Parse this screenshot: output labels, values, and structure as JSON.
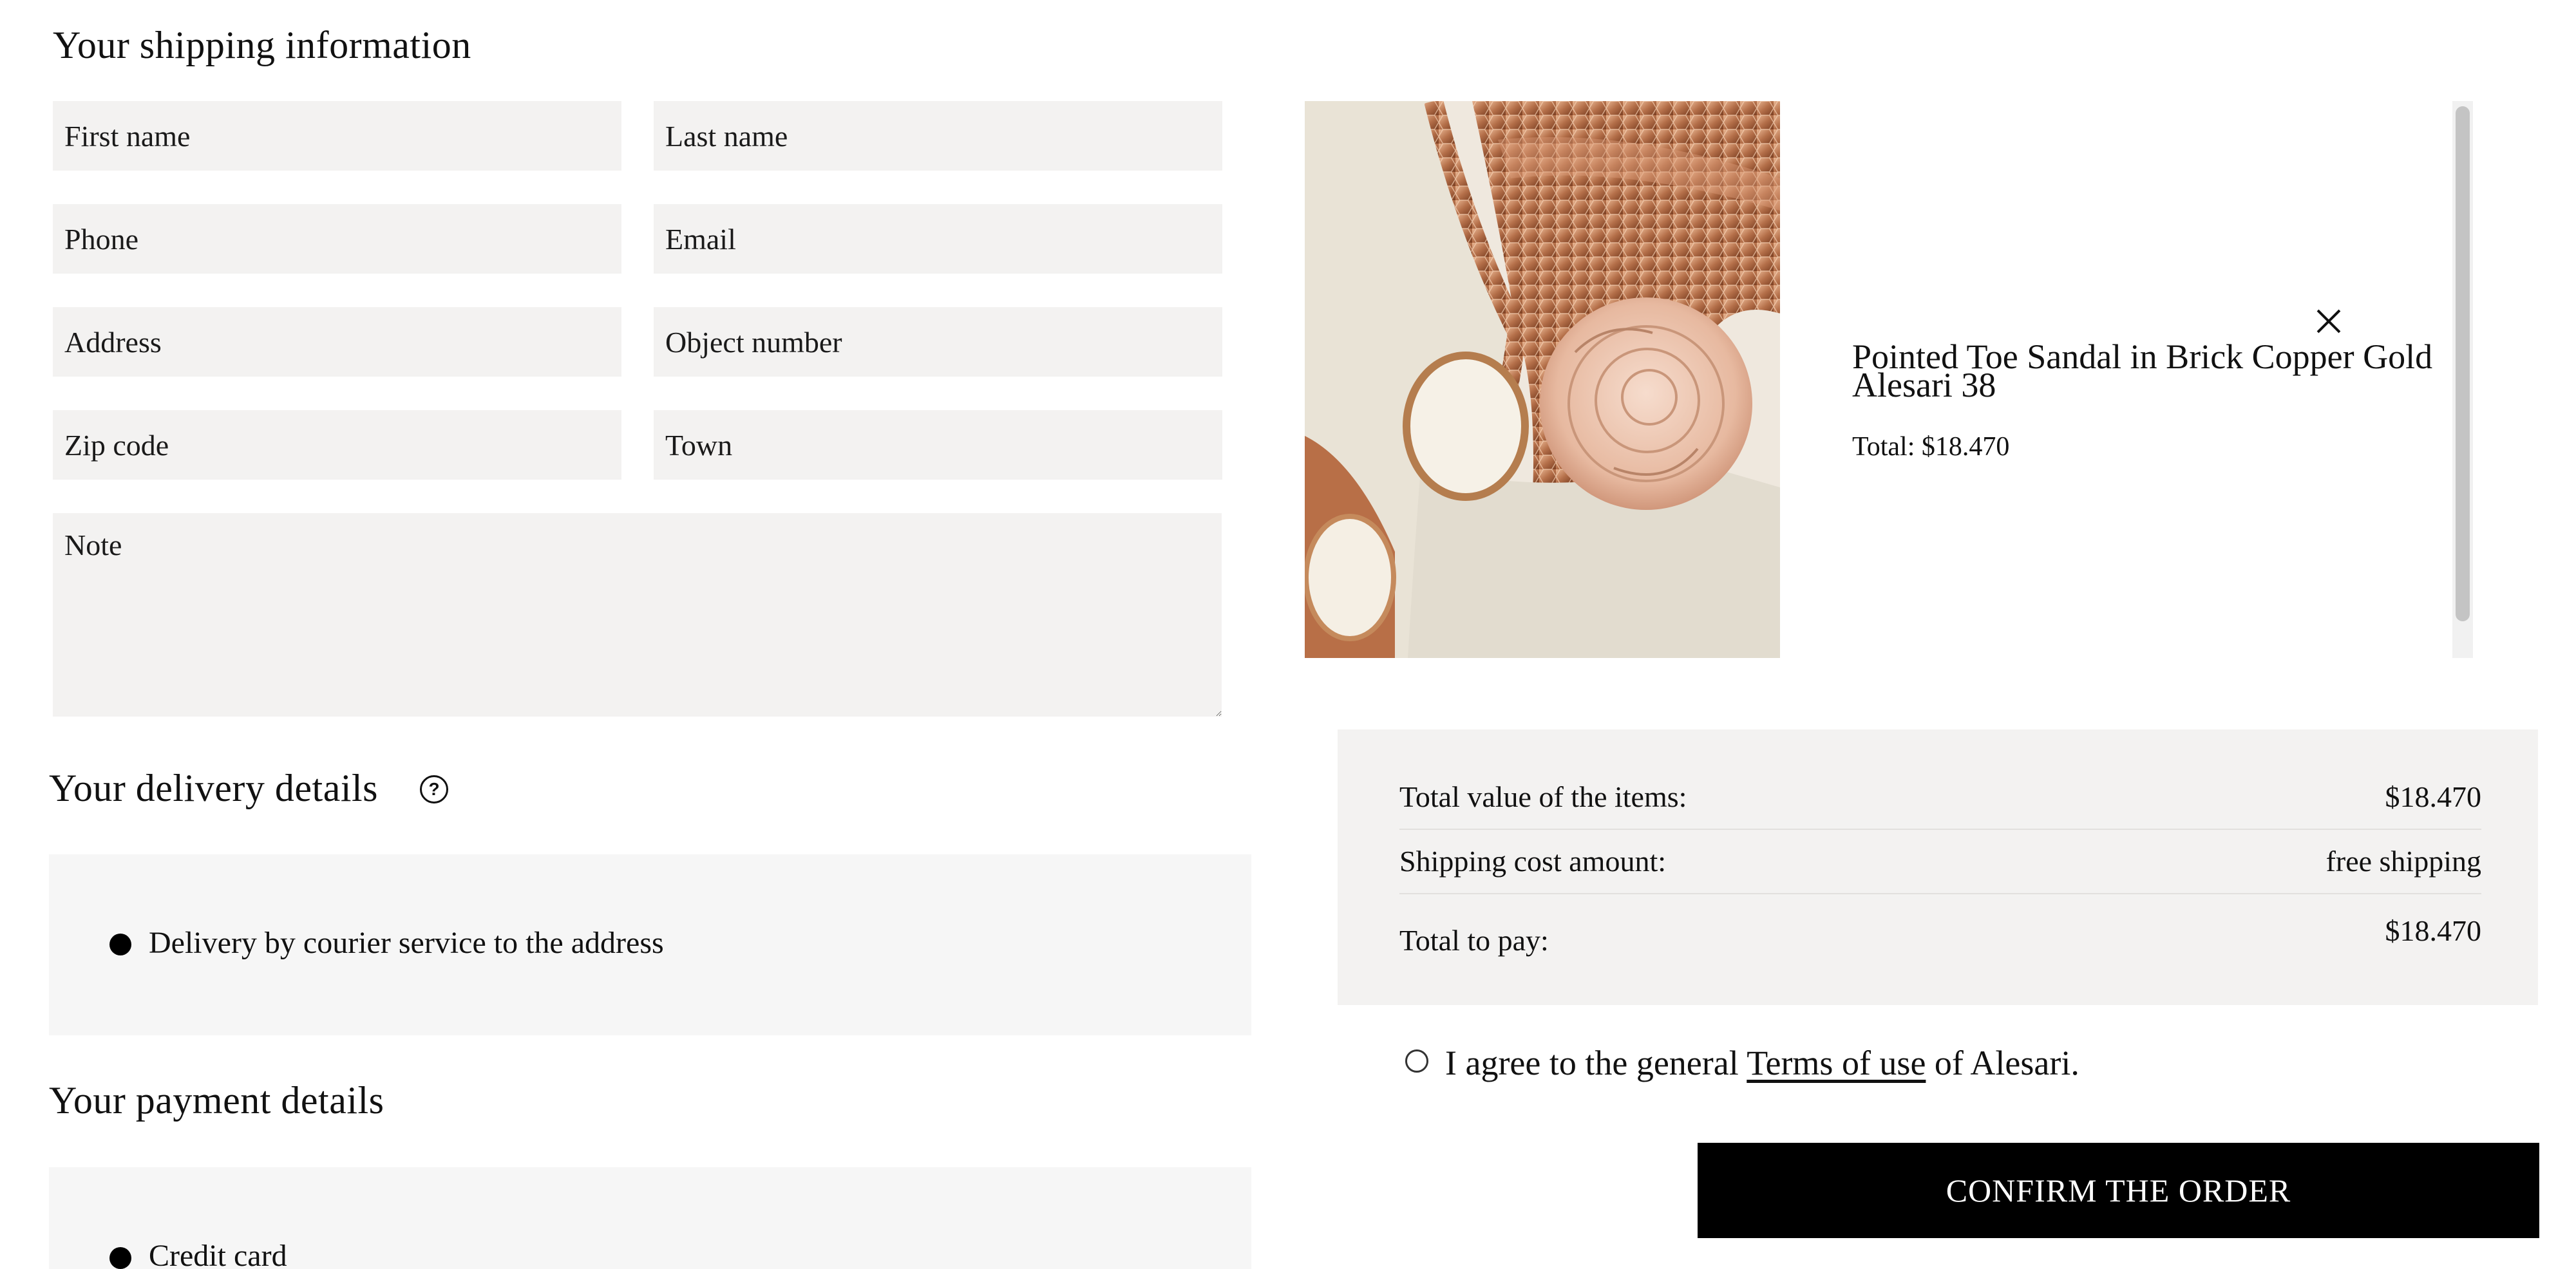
{
  "shipping": {
    "title": "Your shipping information",
    "first_name_placeholder": "First name",
    "last_name_placeholder": "Last name",
    "phone_placeholder": "Phone",
    "email_placeholder": "Email",
    "address_placeholder": "Address",
    "object_number_placeholder": "Object number",
    "zip_placeholder": "Zip code",
    "town_placeholder": "Town",
    "note_placeholder": "Note"
  },
  "delivery": {
    "title": "Your delivery details",
    "help_icon": "question-circle-icon",
    "option_label": "Delivery by courier service to the address"
  },
  "payment": {
    "title": "Your payment details",
    "option_label": "Credit card"
  },
  "product": {
    "name_line1": "Pointed Toe Sandal in Brick Copper Gold",
    "name_line2": "Alesari 38",
    "total": "Total: $18.470",
    "remove_icon": "close-icon"
  },
  "summary": {
    "items_label": "Total value of the items:",
    "items_value": "$18.470",
    "shipping_label": "Shipping cost amount:",
    "shipping_value": "free shipping",
    "pay_label": "Total to pay:",
    "pay_value": "$18.470"
  },
  "terms": {
    "prefix": "I agree to the general",
    "link": "Terms of use",
    "suffix": "of Alesari."
  },
  "confirm_label": "CONFIRM THE ORDER",
  "colors": {
    "field_bg": "#f3f2f1",
    "panel_bg": "#f6f6f6",
    "button_bg": "#000000",
    "button_text": "#ffffff"
  }
}
